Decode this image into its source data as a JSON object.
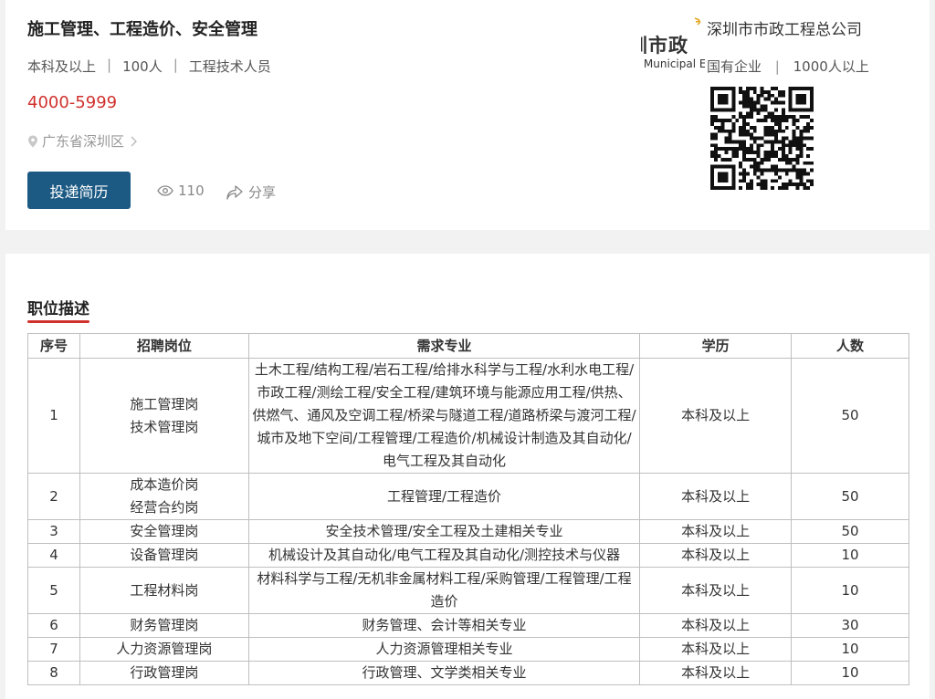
{
  "job": {
    "title": "施工管理、工程造价、安全管理",
    "education": "本科及以上",
    "headcount": "100人",
    "category": "工程技术人员",
    "salary": "4000-5999",
    "location": "广东省深圳区",
    "apply_label": "投递简历",
    "views": "110",
    "share_label": "分享"
  },
  "company": {
    "logo_cn": "圳市政",
    "logo_en": "Shenzhen Municipal Engineering Corporation",
    "name": "深圳市市政工程总公司",
    "type": "国有企业",
    "size": "1000人以上"
  },
  "section": {
    "title": "职位描述"
  },
  "table": {
    "headers": [
      "序号",
      "招聘岗位",
      "需求专业",
      "学历",
      "人数"
    ],
    "rows": [
      {
        "no": "1",
        "positions": [
          "施工管理岗",
          "技术管理岗"
        ],
        "major": "土木工程/结构工程/岩石工程/给排水科学与工程/水利水电工程/市政工程/测绘工程/安全工程/建筑环境与能源应用工程/供热、供燃气、通风及空调工程/桥梁与隧道工程/道路桥梁与渡河工程/城市及地下空间/工程管理/工程造价/机械设计制造及其自动化/电气工程及其自动化",
        "edu": "本科及以上",
        "count": "50"
      },
      {
        "no": "2",
        "positions": [
          "成本造价岗",
          "经营合约岗"
        ],
        "major": "工程管理/工程造价",
        "edu": "本科及以上",
        "count": "50"
      },
      {
        "no": "3",
        "positions": [
          "安全管理岗"
        ],
        "major": "安全技术管理/安全工程及土建相关专业",
        "edu": "本科及以上",
        "count": "50"
      },
      {
        "no": "4",
        "positions": [
          "设备管理岗"
        ],
        "major": "机械设计及其自动化/电气工程及其自动化/测控技术与仪器",
        "edu": "本科及以上",
        "count": "10"
      },
      {
        "no": "5",
        "positions": [
          "工程材料岗"
        ],
        "major": "材料科学与工程/无机非金属材料工程/采购管理/工程管理/工程造价",
        "edu": "本科及以上",
        "count": "10"
      },
      {
        "no": "6",
        "positions": [
          "财务管理岗"
        ],
        "major": "财务管理、会计等相关专业",
        "edu": "本科及以上",
        "count": "30"
      },
      {
        "no": "7",
        "positions": [
          "人力资源管理岗"
        ],
        "major": "人力资源管理相关专业",
        "edu": "本科及以上",
        "count": "10"
      },
      {
        "no": "8",
        "positions": [
          "行政管理岗"
        ],
        "major": "行政管理、文学类相关专业",
        "edu": "本科及以上",
        "count": "10"
      }
    ]
  },
  "icons": {
    "location": "location-pin-icon",
    "views": "eye-icon",
    "share": "share-arrow-icon",
    "arrow": "chevron-right-icon"
  },
  "colors": {
    "accent_button": "#1c5a84",
    "salary": "#d0312d",
    "underline": "#d0312d"
  }
}
